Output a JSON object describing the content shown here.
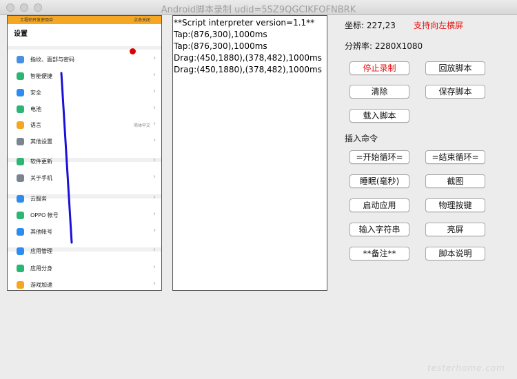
{
  "window": {
    "title": "Android脚本录制 udid=5SZ9QGCIKFOFNBRK"
  },
  "phone": {
    "status_left": "工程师开发使用中",
    "status_right": "点击关闭",
    "heading": "设置",
    "rows": [
      {
        "label": "指纹、面部与密码",
        "value": "",
        "icon": "fingerprint-icon",
        "color": "#4a90e2"
      },
      {
        "label": "智能便捷",
        "value": "",
        "icon": "smart-icon",
        "color": "#2bb673"
      },
      {
        "label": "安全",
        "value": "",
        "icon": "shield-icon",
        "color": "#2d8cf0"
      },
      {
        "label": "电池",
        "value": "",
        "icon": "battery-icon",
        "color": "#2bb673"
      },
      {
        "label": "语言",
        "value": "简体中文",
        "icon": "language-icon",
        "color": "#f5a623"
      },
      {
        "label": "其他设置",
        "value": "",
        "icon": "gear-icon",
        "color": "#7a8591"
      },
      {
        "label": "软件更新",
        "value": "",
        "icon": "update-icon",
        "color": "#2bb673"
      },
      {
        "label": "关于手机",
        "value": "",
        "icon": "info-icon",
        "color": "#7a8591"
      },
      {
        "label": "云服务",
        "value": "",
        "icon": "cloud-icon",
        "color": "#2d8cf0"
      },
      {
        "label": "OPPO 帐号",
        "value": "",
        "icon": "account-icon",
        "color": "#2bb673"
      },
      {
        "label": "其他帐号",
        "value": "",
        "icon": "key-icon",
        "color": "#2d8cf0"
      },
      {
        "label": "应用管理",
        "value": "",
        "icon": "apps-icon",
        "color": "#2d8cf0"
      },
      {
        "label": "应用分身",
        "value": "",
        "icon": "clone-icon",
        "color": "#2bb673"
      },
      {
        "label": "游戏加速",
        "value": "",
        "icon": "game-icon",
        "color": "#f5a623"
      }
    ]
  },
  "script": {
    "lines": [
      "**Script interpreter version=1.1**",
      "Tap:(876,300),1000ms",
      "Tap:(876,300),1000ms",
      "Drag:(450,1880),(378,482),1000ms",
      "Drag:(450,1880),(378,482),1000ms"
    ]
  },
  "panel": {
    "coord_label": "坐标: 227,23",
    "support_label": "支持向左横屏",
    "resolution_label": "分辨率: 2280X1080",
    "insert_label": "插入命令",
    "buttons": {
      "stop": "停止录制",
      "replay": "回放脚本",
      "clear": "清除",
      "save": "保存脚本",
      "load": "载入脚本",
      "loop_start": "=开始循环=",
      "loop_end": "=结束循环=",
      "sleep": "睡眠(毫秒)",
      "screenshot": "截图",
      "launch_app": "启动应用",
      "physical_key": "物理按键",
      "input_text": "输入字符串",
      "wake_screen": "亮屏",
      "comment": "**备注**",
      "help": "脚本说明"
    }
  },
  "watermark": "testerhome.com",
  "colors": {
    "accent_red": "#e81010",
    "status_bar": "#f5a623",
    "drag_line": "#1a10d8"
  }
}
